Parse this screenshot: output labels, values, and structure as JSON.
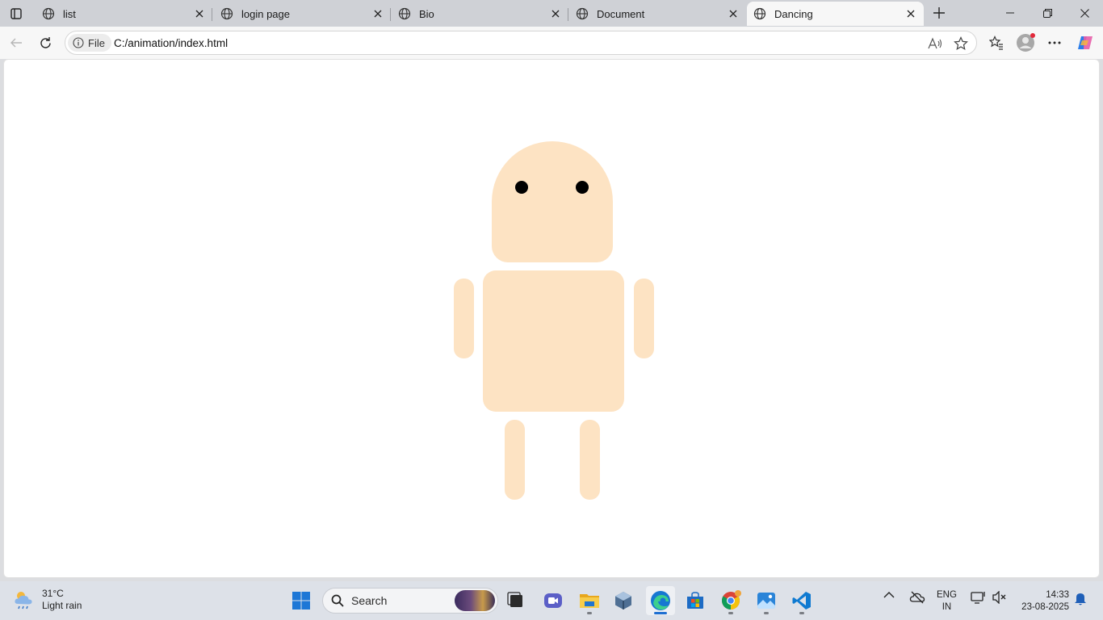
{
  "browser": {
    "tabs": [
      {
        "label": "list",
        "active": false
      },
      {
        "label": "login page",
        "active": false
      },
      {
        "label": "Bio",
        "active": false
      },
      {
        "label": "Document",
        "active": false
      },
      {
        "label": "Dancing",
        "active": true
      }
    ],
    "site_info_label": "File",
    "url": "C:/animation/index.html"
  },
  "page": {
    "robot_color": "#fde3c3",
    "eye_color": "#000000"
  },
  "taskbar": {
    "weather": {
      "temp": "31°C",
      "condition": "Light rain"
    },
    "search_placeholder": "Search",
    "apps": [
      "start",
      "search",
      "task-view",
      "teams-meet",
      "file-explorer",
      "virtualbox",
      "edge",
      "microsoft-store",
      "chrome",
      "photos",
      "vscode"
    ],
    "lang_line1": "ENG",
    "lang_line2": "IN",
    "time": "14:33",
    "date": "23-08-2025"
  }
}
